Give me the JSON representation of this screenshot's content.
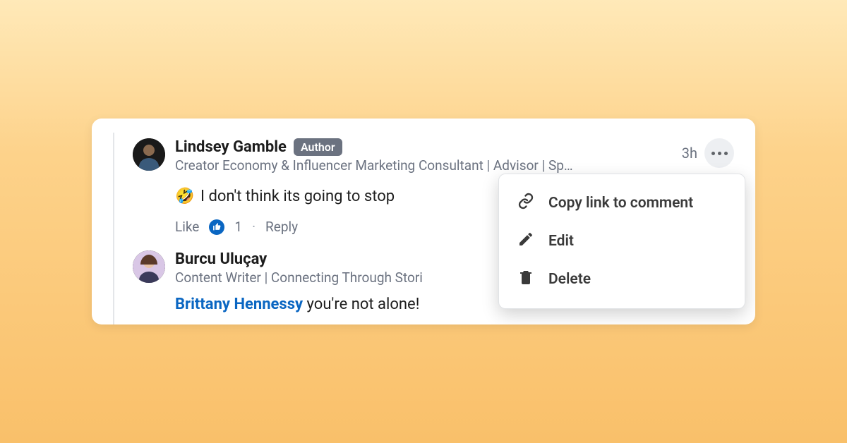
{
  "comments": [
    {
      "name": "Lindsey Gamble",
      "badge": "Author",
      "headline": "Creator Economy & Influencer Marketing Consultant | Advisor | Sp…",
      "time": "3h",
      "emoji": "🤣",
      "text": "I don't think its going to stop",
      "like_label": "Like",
      "like_count": "1",
      "reply_label": "Reply"
    },
    {
      "name": "Burcu Uluçay",
      "headline": "Content Writer | Connecting Through Stori",
      "mention": "Brittany Hennessy",
      "text_rest": " you're not alone!"
    }
  ],
  "menu": {
    "copy": "Copy link to comment",
    "edit": "Edit",
    "delete": "Delete"
  }
}
